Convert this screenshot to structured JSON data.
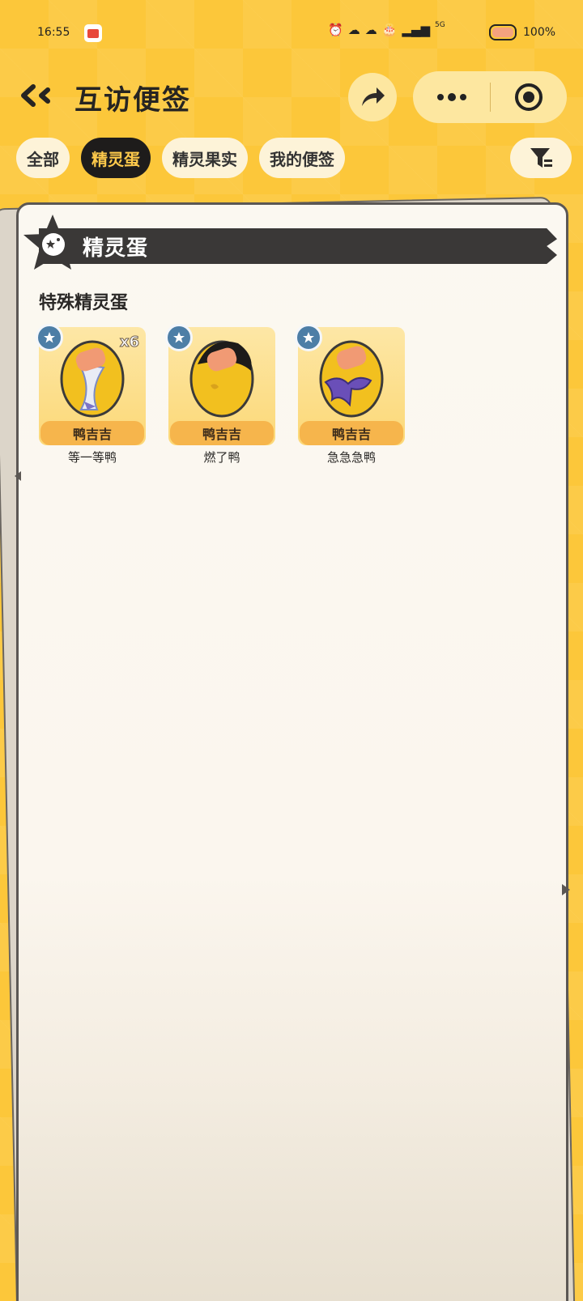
{
  "status_bar": {
    "time": "16:55",
    "network": "5G",
    "battery": "100%"
  },
  "header": {
    "title": "互访便签",
    "icons": {
      "back": "double-chevron-left-icon",
      "share": "share-arrow-icon",
      "more": "more-dots-icon",
      "close": "target-circle-icon"
    }
  },
  "tabs": [
    {
      "label": "全部",
      "active": false
    },
    {
      "label": "精灵蛋",
      "active": true
    },
    {
      "label": "精灵果实",
      "active": false
    },
    {
      "label": "我的便签",
      "active": false
    }
  ],
  "filter_icon": "filter-funnel-icon",
  "section": {
    "banner_title": "精灵蛋",
    "subtitle": "特殊精灵蛋"
  },
  "eggs": [
    {
      "name": "鸭吉吉",
      "caption": "等一等鸭",
      "count": "x6",
      "egg_color": "#f3c428",
      "accent": "hourglass"
    },
    {
      "name": "鸭吉吉",
      "caption": "燃了鸭",
      "count": "",
      "egg_color": "#f3c428",
      "accent": "black-hair"
    },
    {
      "name": "鸭吉吉",
      "caption": "急急急鸭",
      "count": "",
      "egg_color": "#f3c428",
      "accent": "purple-bow"
    }
  ],
  "colors": {
    "background": "#fcc73a",
    "tab_active_bg": "#1e1c1b",
    "tab_active_text": "#fdc94b",
    "banner": "#3a3837",
    "name_strip": "#f6b54c"
  }
}
